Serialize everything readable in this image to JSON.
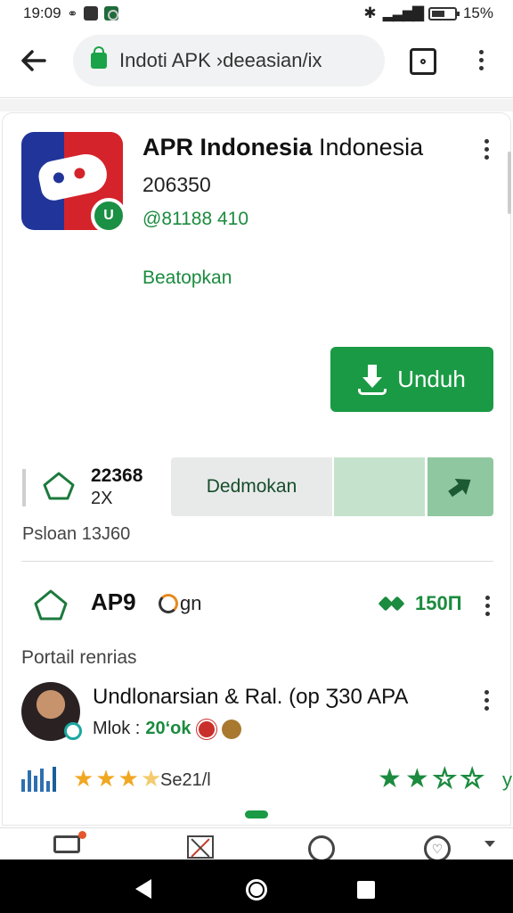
{
  "status_bar": {
    "time": "19:09",
    "battery": "15%"
  },
  "browser": {
    "url": "Indoti APK ›deeasian/ix"
  },
  "app": {
    "title_bold": "APR Indonesia",
    "title_rest": " Indonesia",
    "version": "206350",
    "size": "@81188 410",
    "link": "Beatopkan",
    "download_label": "Unduh",
    "badge_glyph": "U"
  },
  "stats": {
    "count": "22368",
    "multiplier": "2X",
    "suggest_label": "Dedmokan",
    "caption": "Psloan 13J60"
  },
  "row": {
    "label": "AP9",
    "icon_text": "gn",
    "count": "150П"
  },
  "reviews": {
    "section_title": "Portail renrias",
    "review_title": "Undlonarsian & Ral. (op Ʒ30 APA",
    "meta_prefix": "Mlok :",
    "meta_value": "20‘ok",
    "left_rating": 3.5,
    "count_text": "Se21/l",
    "right_rating": 2
  },
  "colors": {
    "accent": "#1a9a44",
    "link_green": "#1b8b3f",
    "star": "#f0a823"
  },
  "icons": {
    "back": "arrow-left-icon",
    "lock": "lock-icon",
    "tabs": "tabs-icon",
    "menu": "more-vert-icon",
    "download": "download-icon",
    "share": "share-icon",
    "house": "house-icon"
  }
}
